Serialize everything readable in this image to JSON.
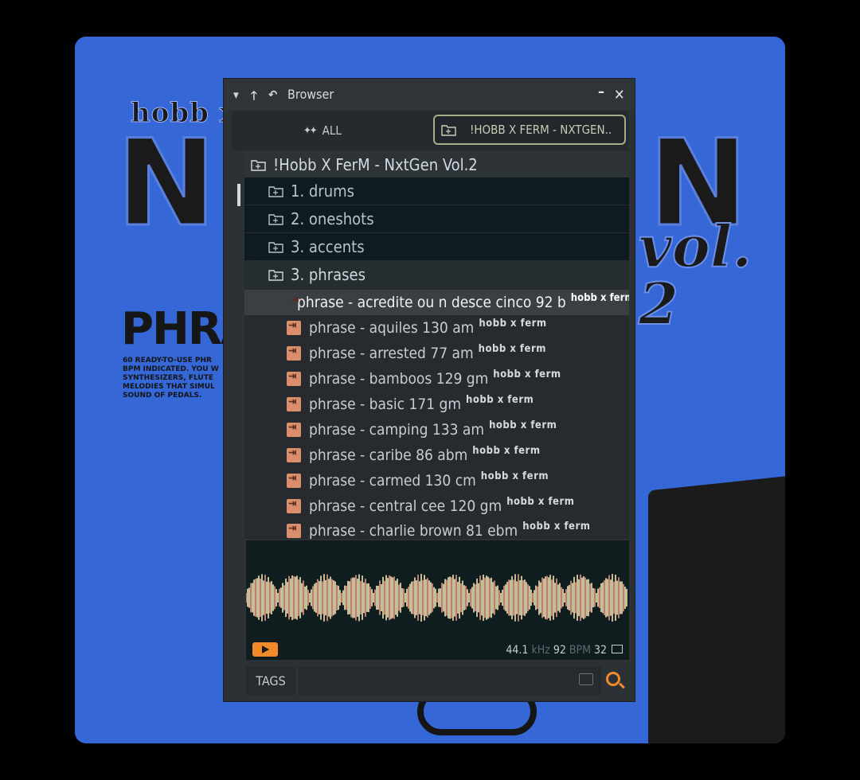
{
  "cover": {
    "top_text": "hobb x fe",
    "big_left": "N",
    "big_right": "N",
    "vol": "vol. 2",
    "phrases_word": "PHRA",
    "description": "60 READY-TO-USE PHR\nBPM INDICATED. YOU W\nSYNTHESIZERS, FLUTE\nMELODIES THAT SIMUL\nSOUND OF PEDALS."
  },
  "window": {
    "title": "Browser",
    "minimize": "–",
    "close": "✕",
    "icons": [
      "chevron-down-icon",
      "arrow-up-icon",
      "undo-icon"
    ]
  },
  "filter": {
    "all_label": "ALL",
    "folder_label": "!HOBB X FERM - NXTGEN.."
  },
  "tree": {
    "root": "!Hobb X FerM - NxtGen Vol.2",
    "folders": [
      "1. drums",
      "2. oneshots",
      "3. accents",
      "3. phrases"
    ],
    "selected_file": {
      "name": "phrase - acredite ou n desce cinco 92 b",
      "tag": "hobb x ferm"
    },
    "files": [
      {
        "name": "phrase - aquiles 130 am",
        "tag": "hobb x ferm"
      },
      {
        "name": "phrase - arrested 77 am",
        "tag": "hobb x ferm"
      },
      {
        "name": "phrase - bamboos 129 gm",
        "tag": "hobb x ferm"
      },
      {
        "name": "phrase - basic 171 gm",
        "tag": "hobb x ferm"
      },
      {
        "name": "phrase - camping 133 am",
        "tag": "hobb x ferm"
      },
      {
        "name": "phrase - caribe 86 abm",
        "tag": "hobb x ferm"
      },
      {
        "name": "phrase - carmed 130 cm",
        "tag": "hobb x ferm"
      },
      {
        "name": "phrase - central cee 120 gm",
        "tag": "hobb x ferm"
      },
      {
        "name": "phrase - charlie brown 81 ebm",
        "tag": "hobb x ferm"
      }
    ]
  },
  "preview": {
    "sample_rate": "44.1",
    "sample_rate_unit": "kHz",
    "bpm": "92",
    "bpm_unit": "BPM",
    "beats": "32"
  },
  "tagbar": {
    "tags_label": "TAGS",
    "input_value": ""
  },
  "colors": {
    "accent": "#f28a2c",
    "folder_border": "#a2ae8c",
    "cover_blue": "#3568d6"
  }
}
